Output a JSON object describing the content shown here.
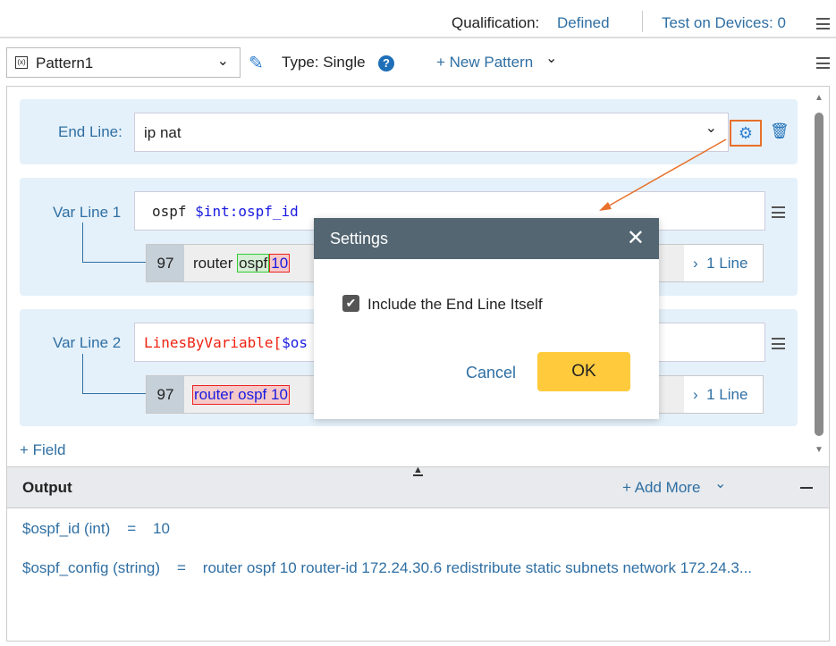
{
  "header": {
    "qualification_label": "Qualification:",
    "qualification_value": "Defined",
    "test_devices": "Test on Devices: 0"
  },
  "toolbar": {
    "pattern": "Pattern1",
    "type": "Type: Single",
    "new_pattern": "+ New Pattern"
  },
  "end_line": {
    "label": "End Line:",
    "value": "ip nat"
  },
  "var_lines": [
    {
      "label": "Var Line 1",
      "expr_plain": "ospf ",
      "expr_var": "$int:ospf_id",
      "line_no": "97",
      "match_plain": "router ",
      "match_green": "ospf",
      "match_red": "10",
      "count": "1 Line"
    },
    {
      "label": "Var Line 2",
      "expr_func": "LinesByVariable[",
      "expr_var": "$os",
      "line_no": "97",
      "match_red": "router ospf 10",
      "count": "1 Line"
    }
  ],
  "add_field": "+ Field",
  "output": {
    "title": "Output",
    "add_more": "+ Add More",
    "rows": [
      {
        "name": "$ospf_id (int)",
        "eq": "=",
        "value": "10"
      },
      {
        "name": "$ospf_config (string)",
        "eq": "=",
        "value": "router ospf 10 router-id 172.24.30.6 redistribute static subnets network 172.24.3..."
      }
    ]
  },
  "dialog": {
    "title": "Settings",
    "checkbox_label": "Include the End Line Itself",
    "checked": true,
    "cancel": "Cancel",
    "ok": "OK"
  },
  "colors": {
    "accent": "#2f6fa3",
    "ok": "#ffcb3d",
    "dialog_header": "#546672",
    "highlight": "#e8702a"
  }
}
